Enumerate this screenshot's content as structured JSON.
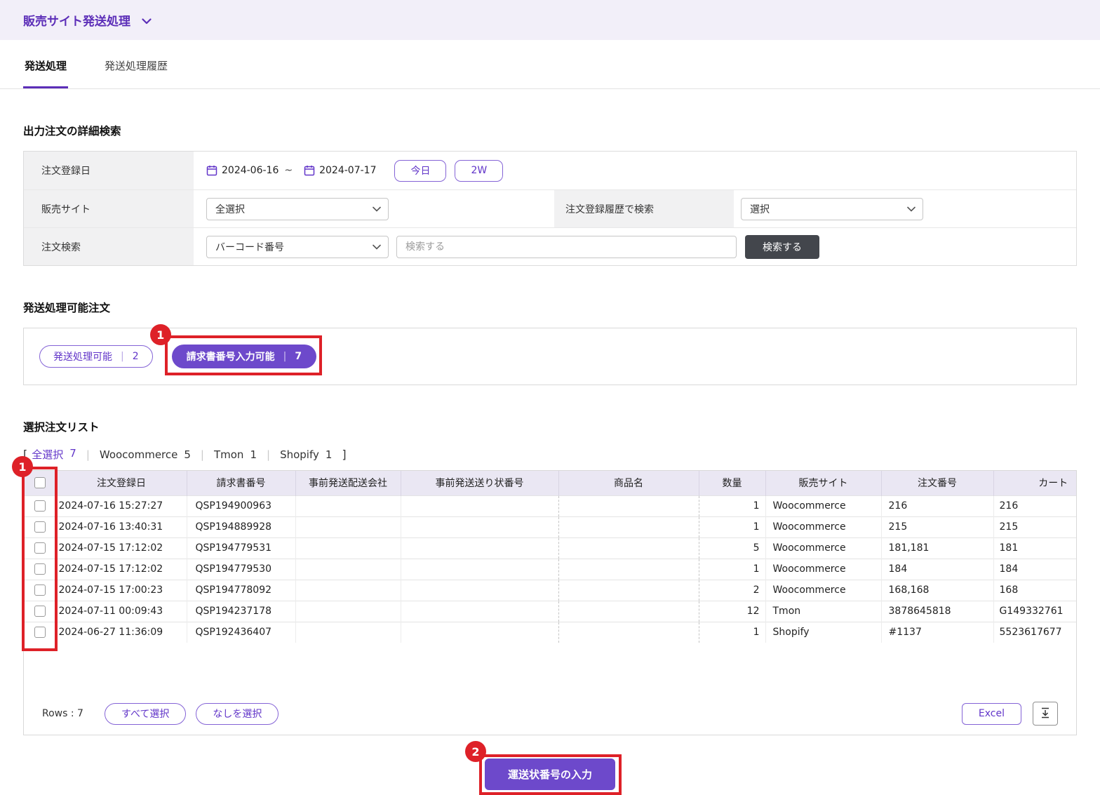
{
  "colors": {
    "accent_purple": "#6236c9",
    "filled_purple": "#6d49cb",
    "annotation_red": "#de2128",
    "dark_button": "#43464c",
    "topbar_bg": "#f2eff9",
    "table_header_bg": "#eae7f3"
  },
  "header": {
    "title": "販売サイト発送処理"
  },
  "tabs": {
    "shipping": "発送処理",
    "history": "発送処理履歴"
  },
  "search": {
    "heading": "出力注文の詳細検索",
    "order_date": {
      "label": "注文登録日",
      "from": "2024-06-16",
      "tilde": "~",
      "to": "2024-07-17",
      "today": "今日",
      "two_weeks": "2W"
    },
    "sales_site": {
      "label": "販売サイト",
      "value": "全選択"
    },
    "order_history": {
      "label": "注文登録履歴で検索",
      "value": "選択"
    },
    "order_search": {
      "label": "注文検索",
      "type_value": "バーコード番号",
      "placeholder": "検索する",
      "button": "検索する"
    }
  },
  "available": {
    "heading": "発送処理可能注文",
    "shippable": {
      "label": "発送処理可能",
      "divider": "|",
      "count": "2"
    },
    "invoice_ready": {
      "label": "請求書番号入力可能",
      "divider": "|",
      "count": "7"
    }
  },
  "selection": {
    "heading": "選択注文リスト",
    "bracket_open": "[",
    "bracket_close": "]",
    "separator": "|",
    "filters": [
      {
        "label": "全選択",
        "count": "7"
      },
      {
        "label": "Woocommerce",
        "count": "5"
      },
      {
        "label": "Tmon",
        "count": "1"
      },
      {
        "label": "Shopify",
        "count": "1"
      }
    ]
  },
  "table": {
    "columns": {
      "date": "注文登録日",
      "invoice": "請求書番号",
      "carrier": "事前発送配送会社",
      "tracking": "事前発送送り状番号",
      "product": "商品名",
      "qty": "数量",
      "site": "販売サイト",
      "order_no": "注文番号",
      "cart": "カート"
    },
    "rows": [
      {
        "date": "2024-07-16 15:27:27",
        "invoice": "QSP194900963",
        "carrier": "",
        "tracking": "",
        "product": "",
        "qty": "1",
        "site": "Woocommerce",
        "order_no": "216",
        "cart": "216"
      },
      {
        "date": "2024-07-16 13:40:31",
        "invoice": "QSP194889928",
        "carrier": "",
        "tracking": "",
        "product": "",
        "qty": "1",
        "site": "Woocommerce",
        "order_no": "215",
        "cart": "215"
      },
      {
        "date": "2024-07-15 17:12:02",
        "invoice": "QSP194779531",
        "carrier": "",
        "tracking": "",
        "product": "",
        "qty": "5",
        "site": "Woocommerce",
        "order_no": "181,181",
        "cart": "181"
      },
      {
        "date": "2024-07-15 17:12:02",
        "invoice": "QSP194779530",
        "carrier": "",
        "tracking": "",
        "product": "",
        "qty": "1",
        "site": "Woocommerce",
        "order_no": "184",
        "cart": "184"
      },
      {
        "date": "2024-07-15 17:00:23",
        "invoice": "QSP194778092",
        "carrier": "",
        "tracking": "",
        "product": "",
        "qty": "2",
        "site": "Woocommerce",
        "order_no": "168,168",
        "cart": "168"
      },
      {
        "date": "2024-07-11 00:09:43",
        "invoice": "QSP194237178",
        "carrier": "",
        "tracking": "",
        "product": "",
        "qty": "12",
        "site": "Tmon",
        "order_no": "3878645818",
        "cart": "G149332761"
      },
      {
        "date": "2024-06-27 11:36:09",
        "invoice": "QSP192436407",
        "carrier": "",
        "tracking": "",
        "product": "",
        "qty": "1",
        "site": "Shopify",
        "order_no": "#1137",
        "cart": "5523617677"
      }
    ],
    "footer": {
      "rows_label": "Rows : 7",
      "select_all": "すべて選択",
      "select_none": "なしを選択",
      "excel": "Excel"
    }
  },
  "bottom": {
    "submit": "運送状番号の入力"
  },
  "annotations": {
    "badge1": "1",
    "badge2": "2"
  }
}
